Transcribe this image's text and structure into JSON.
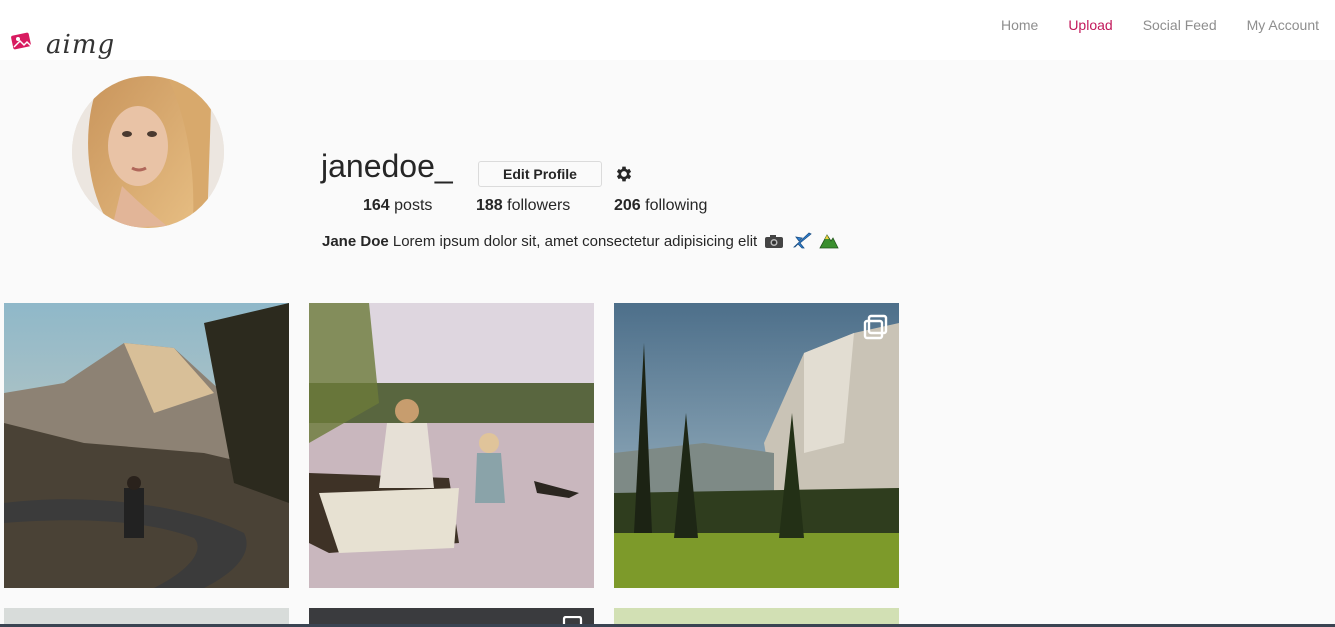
{
  "brand": {
    "logo_text": "aimg"
  },
  "nav": {
    "home": "Home",
    "upload": "Upload",
    "social_feed": "Social Feed",
    "my_account": "My Account"
  },
  "profile": {
    "username": "janedoe_",
    "edit_button": "Edit Profile",
    "stats": {
      "posts_count": "164",
      "posts_label": "posts",
      "followers_count": "188",
      "followers_label": "followers",
      "following_count": "206",
      "following_label": "following"
    },
    "bio": {
      "name": "Jane Doe",
      "text": "Lorem ipsum dolor sit, amet consectetur adipisicing elit"
    },
    "bio_icons": [
      "camera-icon",
      "airplane-icon",
      "mountain-icon"
    ]
  },
  "colors": {
    "accent": "#c2185b",
    "nav_text": "#8e8e8e"
  }
}
